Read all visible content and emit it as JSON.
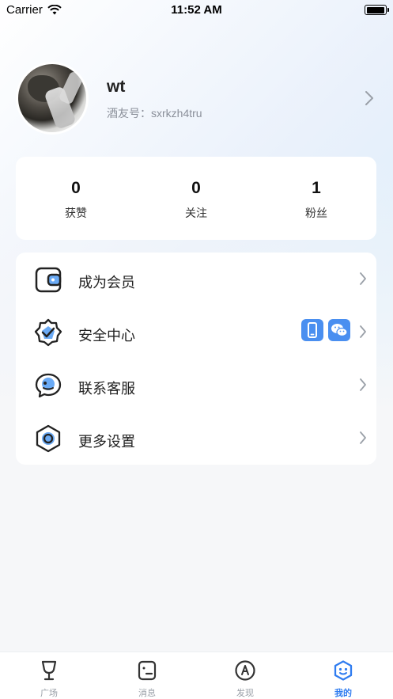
{
  "status_bar": {
    "carrier": "Carrier",
    "time": "11:52 AM"
  },
  "profile": {
    "username": "wt",
    "user_id": "酒友号：sxrkzh4tru"
  },
  "stats": [
    {
      "value": "0",
      "label": "获赞"
    },
    {
      "value": "0",
      "label": "关注"
    },
    {
      "value": "1",
      "label": "粉丝"
    }
  ],
  "menu": [
    {
      "label": "成为会员",
      "icon": "wallet-icon"
    },
    {
      "label": "安全中心",
      "icon": "shield-check-icon",
      "badges": [
        "phone-icon",
        "wechat-icon"
      ]
    },
    {
      "label": "联系客服",
      "icon": "chat-bubble-icon"
    },
    {
      "label": "更多设置",
      "icon": "settings-hexagon-icon"
    }
  ],
  "tabbar": [
    {
      "label": "广场",
      "icon": "wine-glass-icon",
      "active": false
    },
    {
      "label": "消息",
      "icon": "message-icon",
      "active": false
    },
    {
      "label": "发现",
      "icon": "compass-icon",
      "active": false
    },
    {
      "label": "我的",
      "icon": "profile-face-icon",
      "active": true
    }
  ],
  "colors": {
    "accent": "#2f7cf0",
    "icon_fill": "#6aaaf5",
    "badge": "#4a8ff0"
  }
}
